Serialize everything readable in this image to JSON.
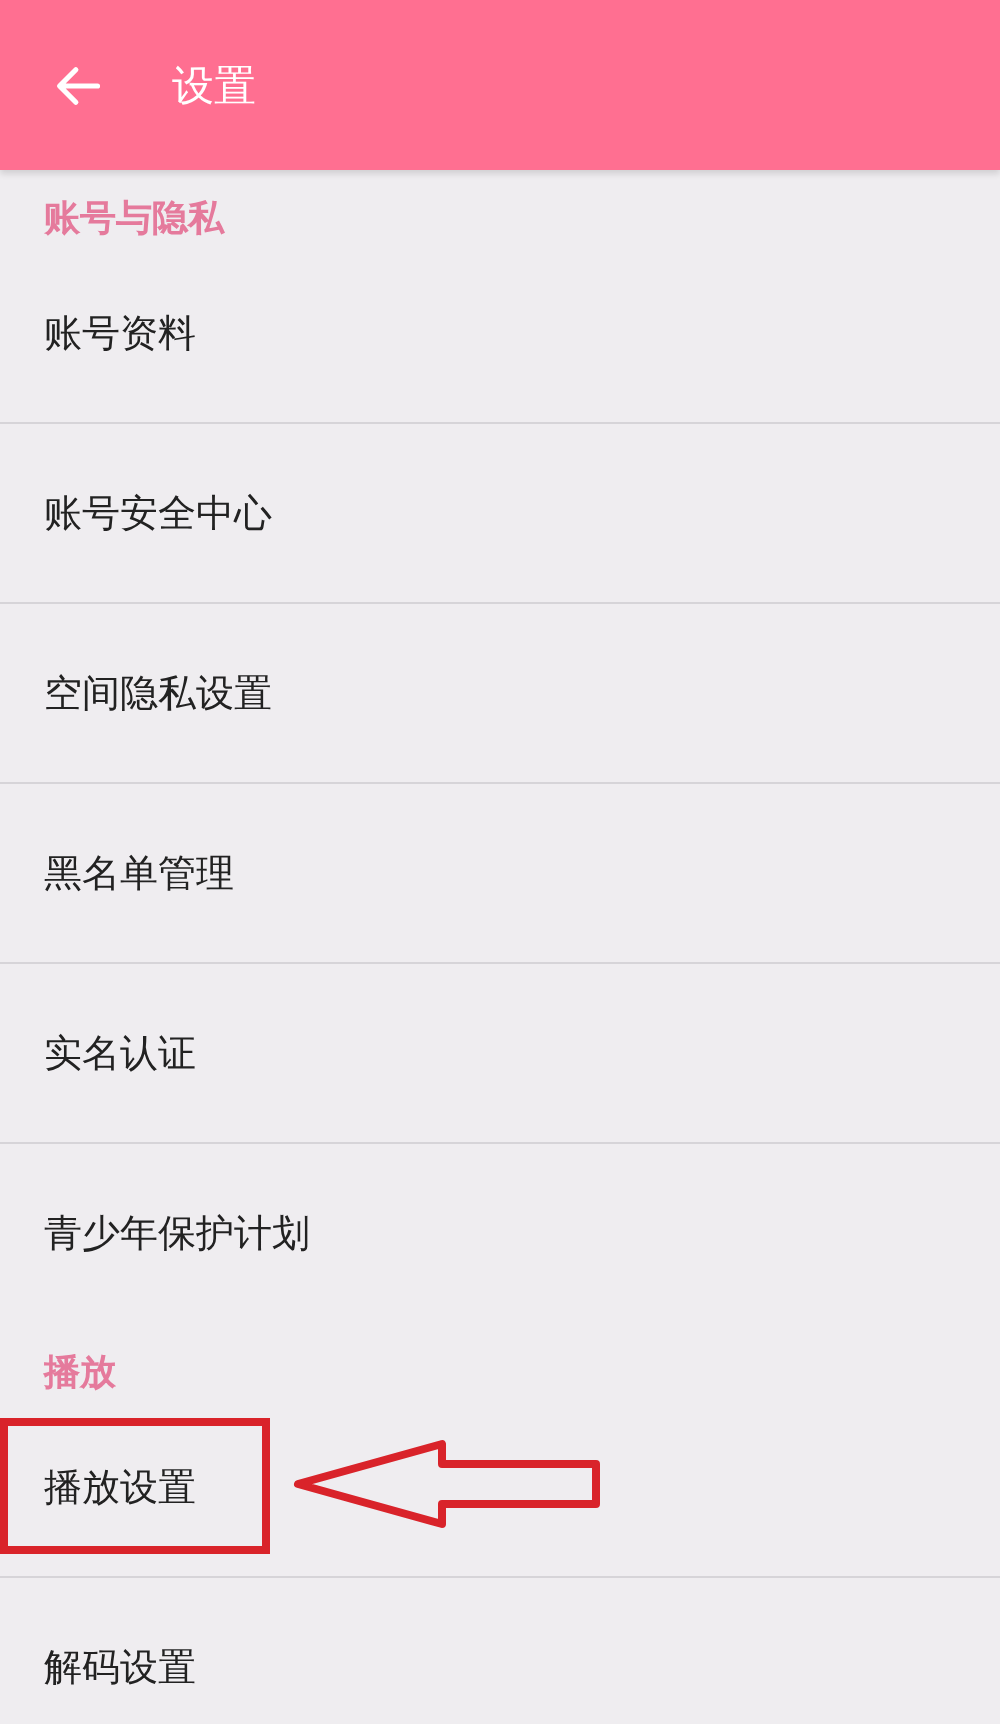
{
  "header": {
    "title": "设置"
  },
  "sections": [
    {
      "title": "账号与隐私",
      "items": [
        {
          "label": "账号资料",
          "highlighted": false
        },
        {
          "label": "账号安全中心",
          "highlighted": false
        },
        {
          "label": "空间隐私设置",
          "highlighted": false
        },
        {
          "label": "黑名单管理",
          "highlighted": false
        },
        {
          "label": "实名认证",
          "highlighted": false
        },
        {
          "label": "青少年保护计划",
          "highlighted": false
        }
      ]
    },
    {
      "title": "播放",
      "items": [
        {
          "label": "播放设置",
          "highlighted": true
        },
        {
          "label": "解码设置",
          "highlighted": false
        }
      ]
    }
  ]
}
